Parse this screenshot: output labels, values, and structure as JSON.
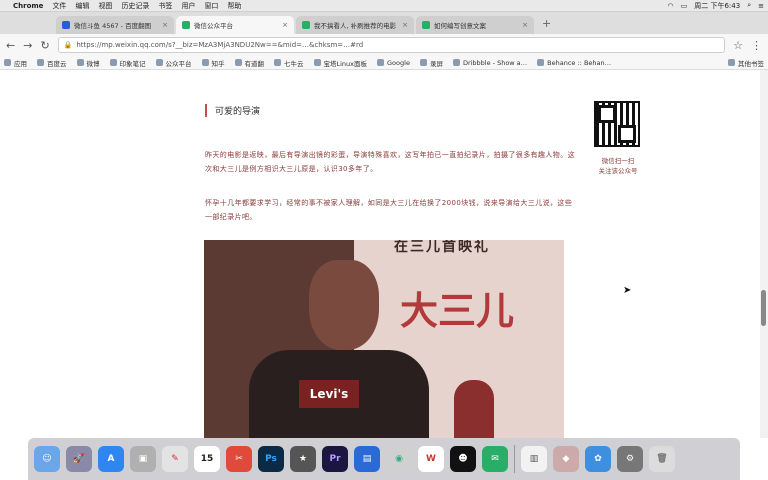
{
  "menubar": {
    "app": "Chrome",
    "items": [
      "文件",
      "编辑",
      "视图",
      "历史记录",
      "书签",
      "用户",
      "窗口",
      "帮助"
    ],
    "clock": "周二 下午6:43"
  },
  "tabs": [
    {
      "label": "微信斗鱼 4567 - 百度翻图"
    },
    {
      "label": "微信公众平台"
    },
    {
      "label": "我不搞看人, 补刷推荐的电影"
    },
    {
      "label": "如何编写创意文案"
    }
  ],
  "address": {
    "url": "https://mp.weixin.qq.com/s?__biz=MzA3MjA3NDU2Nw==&mid=…&chksm=…#rd"
  },
  "bookmarks": {
    "items": [
      "应用",
      "百度云",
      "微博",
      "印象笔记",
      "公众平台",
      "知乎",
      "有道翻",
      "七牛云",
      "宝塔Linux面板",
      "Google",
      "录屏",
      "Dribbble - Show a…",
      "Behance :: Behan…"
    ],
    "other": "其他书签"
  },
  "article": {
    "section_title": "可爱的导演",
    "para1": "昨天的电影是返映，最后有导演出镜的彩蛋，导演特殊喜欢，这写年拍已一直拍纪录片，拍摄了很多有趣人物。这次和大三儿是例方相识大三儿原是，认识30多年了。",
    "para2": "怀孕十几年都要求学习，经常的事不被家人理解，如同是大三儿在给换了2000块钱，说来导演给大三儿说，这些一部纪录片吧。",
    "photo_banner": "在三儿首映礼",
    "photo_bigchar": "大三儿",
    "photo_logo": "Levi's"
  },
  "qr": {
    "caption": "微信扫一扫\n关注该公众号"
  },
  "dock": {
    "apps": [
      "finder",
      "launchpad",
      "app-store",
      "preview",
      "safari",
      "calendar",
      "clipper",
      "photoshop",
      "imovie",
      "premiere",
      "keynote",
      "chrome",
      "wps",
      "qq",
      "wechat",
      "pages",
      "sketch",
      "share",
      "settings",
      "trash"
    ]
  }
}
